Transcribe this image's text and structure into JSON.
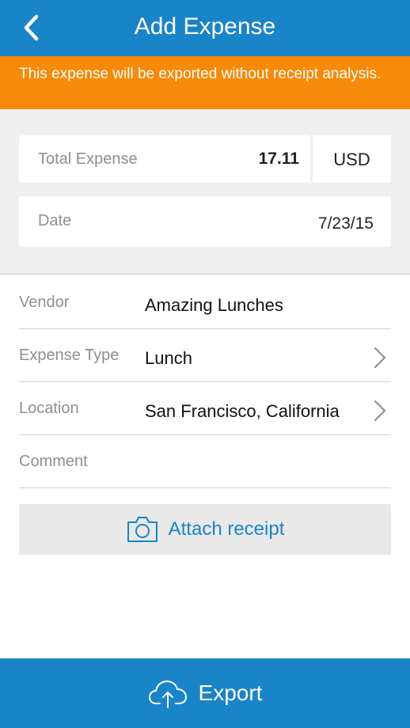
{
  "header": {
    "title": "Add Expense",
    "back_icon": "chevron-left-icon"
  },
  "banner": {
    "text": "This expense will be exported without receipt analysis."
  },
  "amount": {
    "label": "Total Expense",
    "value": "17.11",
    "currency": "USD"
  },
  "date": {
    "label": "Date",
    "value": "7/23/15"
  },
  "fields": {
    "vendor": {
      "label": "Vendor",
      "value": "Amazing Lunches"
    },
    "expense_type": {
      "label": "Expense Type",
      "value": "Lunch",
      "icon": "chevron-right-icon"
    },
    "location": {
      "label": "Location",
      "value": "San Francisco, California",
      "icon": "chevron-right-icon"
    },
    "comment": {
      "label": "Comment",
      "value": ""
    }
  },
  "attach": {
    "label": "Attach receipt",
    "icon": "camera-icon"
  },
  "footer": {
    "label": "Export",
    "icon": "cloud-upload-icon"
  },
  "colors": {
    "primary": "#1a84c8",
    "warning": "#f78a08",
    "background_gray": "#efeff0"
  }
}
